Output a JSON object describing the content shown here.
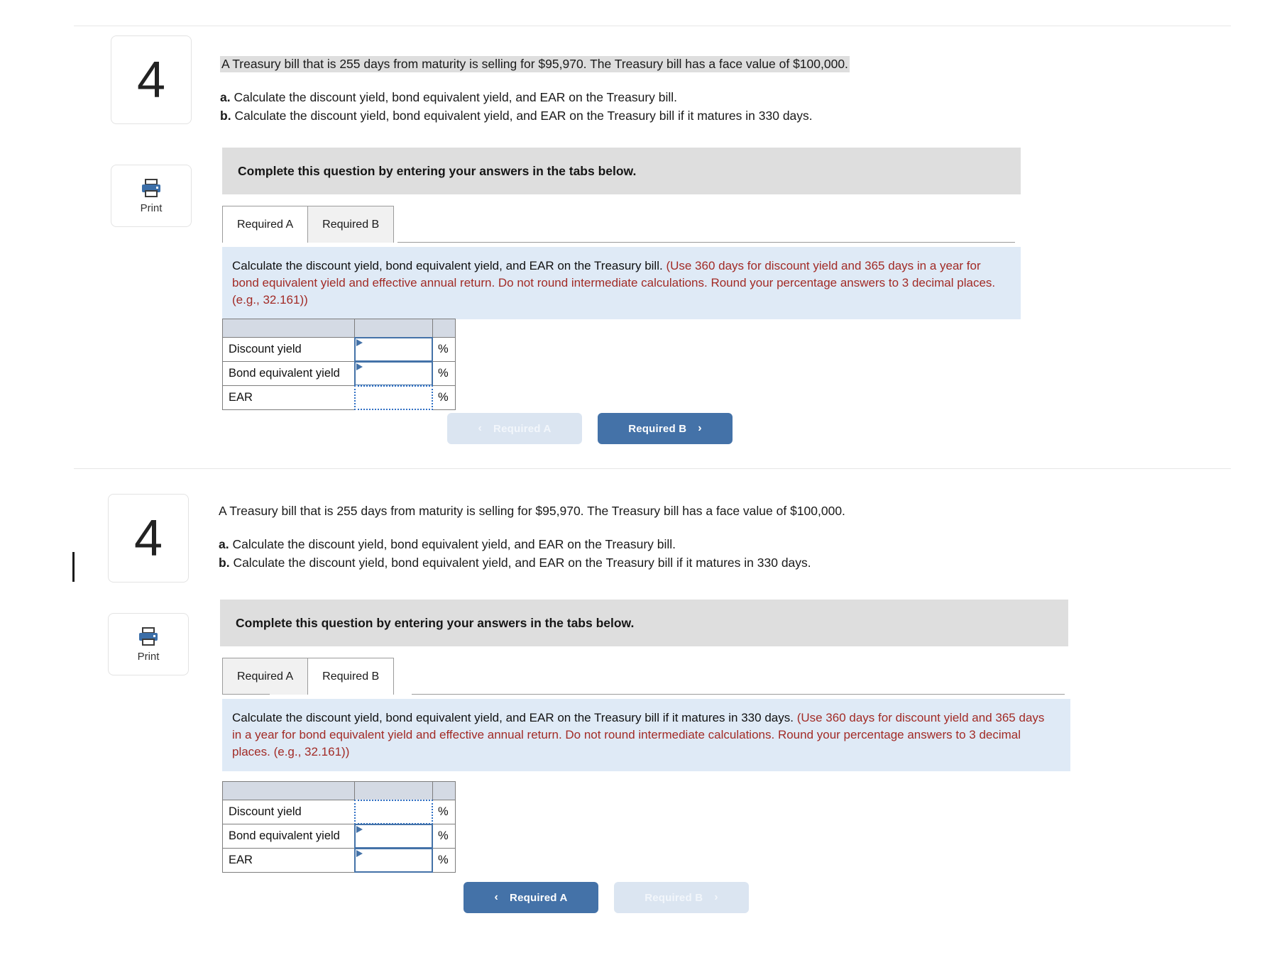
{
  "question": {
    "number": "4",
    "stem": "A Treasury bill that is 255 days from maturity is selling for $95,970. The Treasury bill has a face value of $100,000.",
    "part_a_marker": "a.",
    "part_a": "Calculate the discount yield, bond equivalent yield, and EAR on the Treasury bill.",
    "part_b_marker": "b.",
    "part_b": "Calculate the discount yield, bond equivalent yield, and EAR on the Treasury bill if it matures in 330 days."
  },
  "print": {
    "label": "Print",
    "icon": "printer-icon"
  },
  "instruction_bar": "Complete this question by entering your answers in the tabs below.",
  "tabs": [
    {
      "label": "Required A"
    },
    {
      "label": "Required B"
    }
  ],
  "panel_a": {
    "active_tab": "Required A",
    "callout_black": "Calculate the discount yield, bond equivalent yield, and EAR on the Treasury bill.",
    "callout_red": "(Use 360 days for discount yield and 365 days in a year for bond equivalent yield and effective annual return. Do not round intermediate calculations. Round your percentage answers to 3 decimal places. (e.g., 32.161))",
    "rows": [
      {
        "label": "Discount yield",
        "value": "",
        "unit": "%",
        "focused": false
      },
      {
        "label": "Bond equivalent yield",
        "value": "",
        "unit": "%",
        "focused": false
      },
      {
        "label": "EAR",
        "value": "",
        "unit": "%",
        "focused": true
      }
    ],
    "nav": {
      "prev_label": "Required A",
      "prev_chevron": "‹",
      "prev_state": "disabled",
      "next_label": "Required B",
      "next_chevron": "›",
      "next_state": "primary"
    }
  },
  "panel_b": {
    "active_tab": "Required B",
    "callout_black": "Calculate the discount yield, bond equivalent yield, and EAR on the Treasury bill if it matures in 330 days.",
    "callout_red": "(Use 360 days for discount yield and 365 days in a year for bond equivalent yield and effective annual return. Do not round intermediate calculations. Round your percentage answers to 3 decimal places. (e.g., 32.161))",
    "rows": [
      {
        "label": "Discount yield",
        "value": "",
        "unit": "%",
        "focused": true
      },
      {
        "label": "Bond equivalent yield",
        "value": "",
        "unit": "%",
        "focused": false
      },
      {
        "label": "EAR",
        "value": "",
        "unit": "%",
        "focused": false
      }
    ],
    "nav": {
      "prev_label": "Required A",
      "prev_chevron": "‹",
      "prev_state": "primary",
      "next_label": "Required B",
      "next_chevron": "›",
      "next_state": "disabled"
    }
  },
  "colors": {
    "accent_blue": "#4472a8",
    "callout_bg": "#dfeaf6",
    "red_text": "#a22b26",
    "gray_bar": "#dedede",
    "table_header": "#d4dae4"
  }
}
